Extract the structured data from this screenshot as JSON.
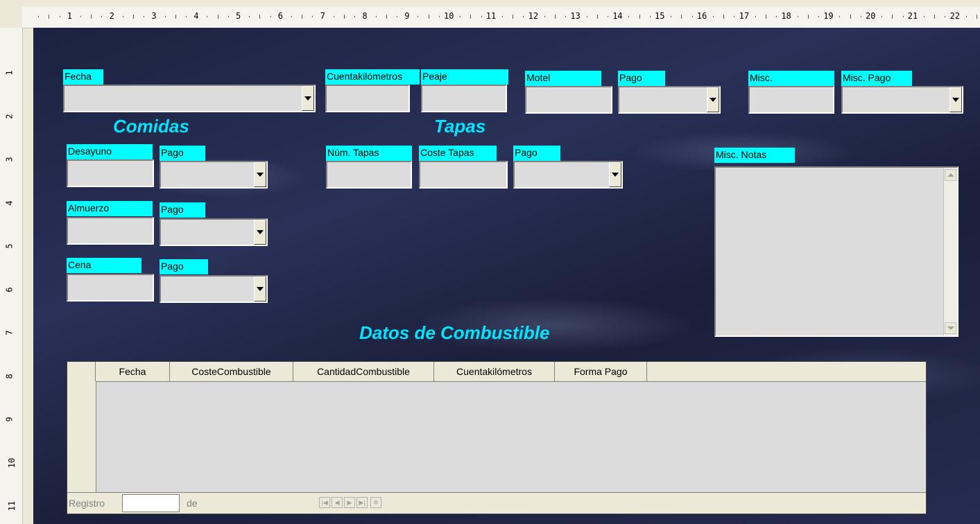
{
  "ruler": {
    "top_numbers": [
      "1",
      "2",
      "3",
      "4",
      "5",
      "6",
      "7",
      "8",
      "9",
      "10",
      "11",
      "12",
      "13",
      "14",
      "15",
      "16",
      "17",
      "18",
      "19",
      "20",
      "21",
      "22"
    ],
    "left_numbers": [
      "1",
      "2",
      "3",
      "4",
      "5",
      "6",
      "7",
      "8",
      "9",
      "10",
      "11"
    ]
  },
  "form": {
    "labels": {
      "fecha": "Fecha",
      "cuentakm": "Cuentakilómetros",
      "peaje": "Peaje",
      "motel": "Motel",
      "pago_motel": "Pago",
      "misc": "Misc.",
      "misc_pago": "Misc. Pago",
      "desayuno": "Desayuno",
      "pago_desayuno": "Pago",
      "almuerzo": "Almuerzo",
      "pago_almuerzo": "Pago",
      "cena": "Cena",
      "pago_cena": "Pago",
      "num_tapas": "Núm. Tapas",
      "coste_tapas": "Coste Tapas",
      "pago_tapas": "Pago",
      "misc_notas": "Misc. Notas"
    },
    "headings": {
      "comidas": "Comidas",
      "tapas": "Tapas",
      "combustible": "Datos de Combustible"
    }
  },
  "grid": {
    "columns": [
      "Fecha",
      "CosteCombustible",
      "CantidadCombustible",
      "Cuentakilómetros",
      "Forma Pago"
    ],
    "nav": {
      "registro": "Registro",
      "de": "de"
    }
  },
  "colors": {
    "label_bg": "#00ffff",
    "heading": "#00e5ff",
    "field_bg": "#dcdcdc"
  }
}
